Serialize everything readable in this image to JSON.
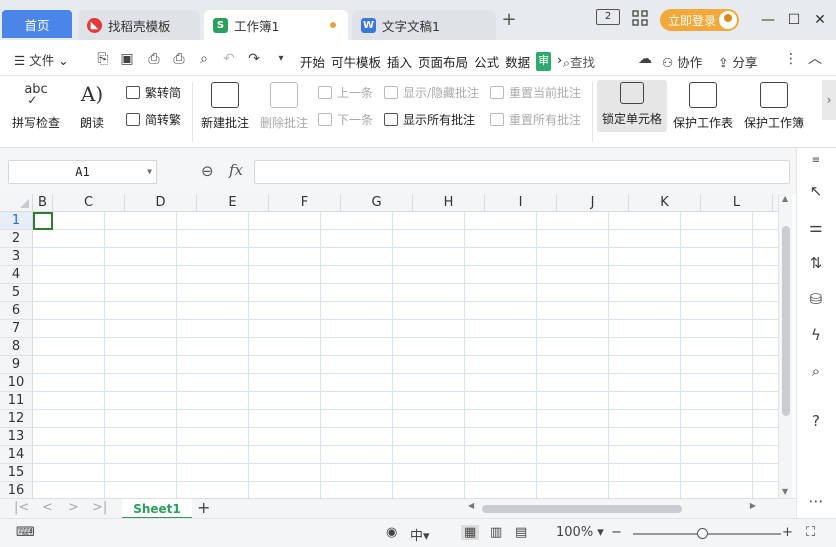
{
  "tabs": {
    "home": "首页",
    "template": "找稻壳模板",
    "workbook": "工作簿1",
    "workbook_icon": "S",
    "document": "文字文稿1",
    "document_icon": "W",
    "add": "+"
  },
  "header": {
    "login": "立即登录",
    "page_badge": "2"
  },
  "menu": {
    "file": "文件",
    "tabs": [
      "开始",
      "可牛模板",
      "插入",
      "页面布局",
      "公式",
      "数据"
    ],
    "review_badge": "审",
    "search": "查找",
    "collab": "协作",
    "share": "分享"
  },
  "ribbon": {
    "spell_check": "拼写检查",
    "read_aloud": "朗读",
    "trad_simp": "繁转简",
    "simp_trad": "简转繁",
    "new_comment": "新建批注",
    "delete_comment": "删除批注",
    "prev": "上一条",
    "next": "下一条",
    "show_hide_comment": "显示/隐藏批注",
    "show_all_comments": "显示所有批注",
    "reset_current": "重置当前批注",
    "reset_all": "重置所有批注",
    "lock_cell": "锁定单元格",
    "protect_sheet": "保护工作表",
    "protect_book": "保护工作簿",
    "abc": "abc"
  },
  "formula": {
    "cell_ref": "A1",
    "fx": "fx",
    "value": ""
  },
  "grid": {
    "columns": [
      "B",
      "C",
      "D",
      "E",
      "F",
      "G",
      "H",
      "I",
      "J",
      "K",
      "L"
    ],
    "rows": [
      "1",
      "2",
      "3",
      "4",
      "5",
      "6",
      "7",
      "8",
      "9",
      "10",
      "11",
      "12",
      "13",
      "14",
      "15",
      "16"
    ],
    "selected_row": "1"
  },
  "sheets": {
    "active": "Sheet1",
    "add": "+"
  },
  "status": {
    "zoom": "100%",
    "minus": "−",
    "plus": "+"
  },
  "colors": {
    "accent_green": "#2aa05a",
    "home_tab": "#4a86e8",
    "login": "#f2a83a"
  }
}
